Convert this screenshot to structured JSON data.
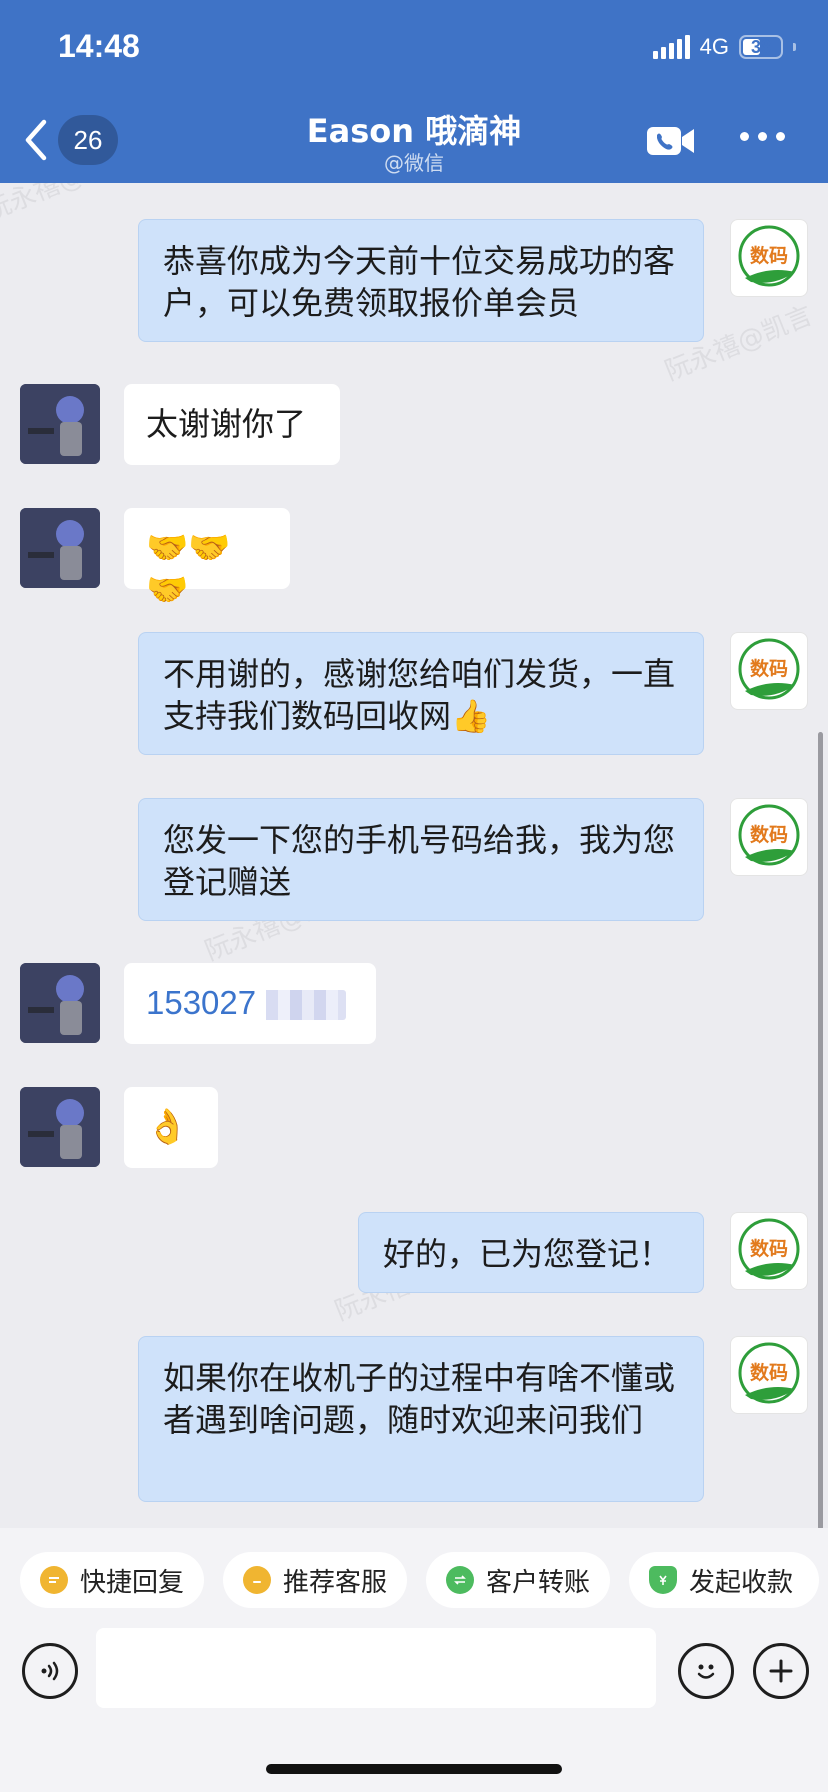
{
  "status": {
    "time": "14:48",
    "network": "4G",
    "battery": "38"
  },
  "header": {
    "back_count": "26",
    "title": "Eason 哦滴神",
    "subtitle": "@微信"
  },
  "brand_colors": {
    "header": "#3f73c6",
    "outgoing_bubble": "#cfe2fa",
    "incoming_bubble": "#ffffff",
    "link": "#3b74cc"
  },
  "avatar_logo_text": "数码",
  "messages": [
    {
      "side": "out",
      "text": "恭喜你成为今天前十位交易成功的客户，可以免费领取报价单会员"
    },
    {
      "side": "in",
      "text": "太谢谢你了"
    },
    {
      "side": "in",
      "text": "🤝🤝🤝"
    },
    {
      "side": "out",
      "text": "不用谢的，感谢您给咱们发货，一直支持我们数码回收网👍"
    },
    {
      "side": "out",
      "text": "您发一下您的手机号码给我，我为您登记赠送"
    },
    {
      "side": "in",
      "text": "153027"
    },
    {
      "side": "in",
      "text": "👌"
    },
    {
      "side": "out",
      "text": "好的，已为您登记！"
    },
    {
      "side": "out",
      "text": "如果你在收机子的过程中有啥不懂或者遇到啥问题，随时欢迎来问我们"
    }
  ],
  "watermark_text": "阮永禧@凯言",
  "quick_actions": [
    {
      "label": "快捷回复",
      "icon": "quick-reply-icon",
      "color": "#f0b531"
    },
    {
      "label": "推荐客服",
      "icon": "recommend-service-icon",
      "color": "#f0b531"
    },
    {
      "label": "客户转账",
      "icon": "transfer-icon",
      "color": "#4dbb5f"
    },
    {
      "label": "发起收款",
      "icon": "collect-payment-icon",
      "color": "#4dbb5f"
    }
  ]
}
